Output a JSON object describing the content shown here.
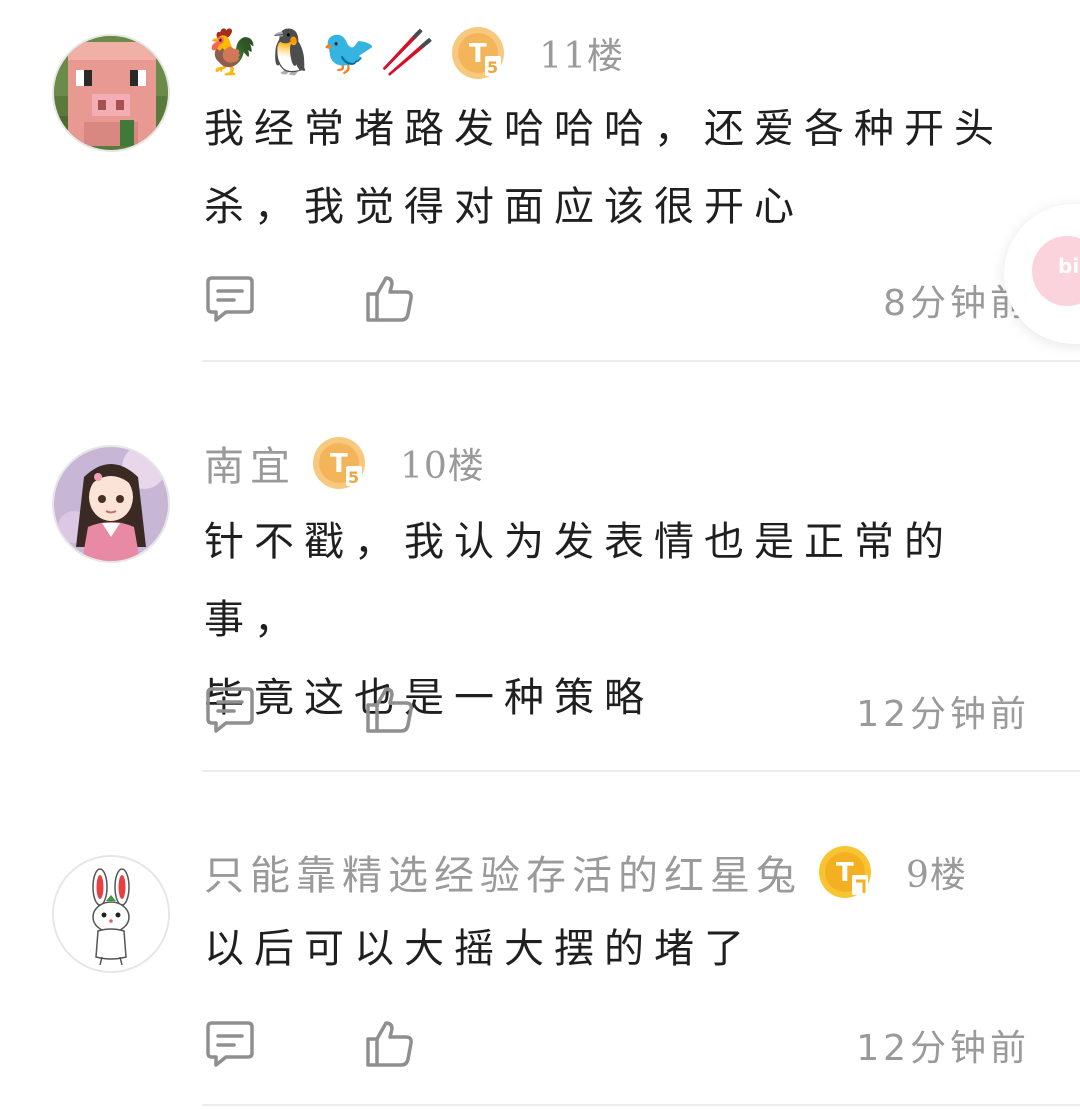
{
  "comments": [
    {
      "username": "",
      "emoji_flair": [
        "🐓",
        "🐧",
        "🐦",
        "🥢"
      ],
      "level": "T5",
      "floor": "11楼",
      "content_lines": [
        "我经常堵路发哈哈哈，还爱各种开头",
        "杀，我觉得对面应该很开心"
      ],
      "time": "8分钟前",
      "avatar_icon": "pig-avatar-icon"
    },
    {
      "username": "南宜",
      "level": "T5",
      "floor": "10楼",
      "content_lines": [
        "针不戳，我认为发表情也是正常的事，",
        "毕竟这也是一种策略"
      ],
      "time": "12分钟前",
      "avatar_icon": "anime-girl-avatar-icon"
    },
    {
      "username": "只能靠精选经验存活的红星兔",
      "level": "T1",
      "floor": "9楼",
      "content_lines": [
        "以后可以大摇大摆的堵了"
      ],
      "time": "12分钟前",
      "avatar_icon": "rabbit-avatar-icon"
    }
  ],
  "floating_button": {
    "logo_text": "bili",
    "accent_color": "#fbd3dc"
  },
  "colors": {
    "meta_text": "#9a9a9a",
    "body_text": "#1f1f1f",
    "badge_gold": "#f2b13a",
    "divider": "#ececec"
  }
}
